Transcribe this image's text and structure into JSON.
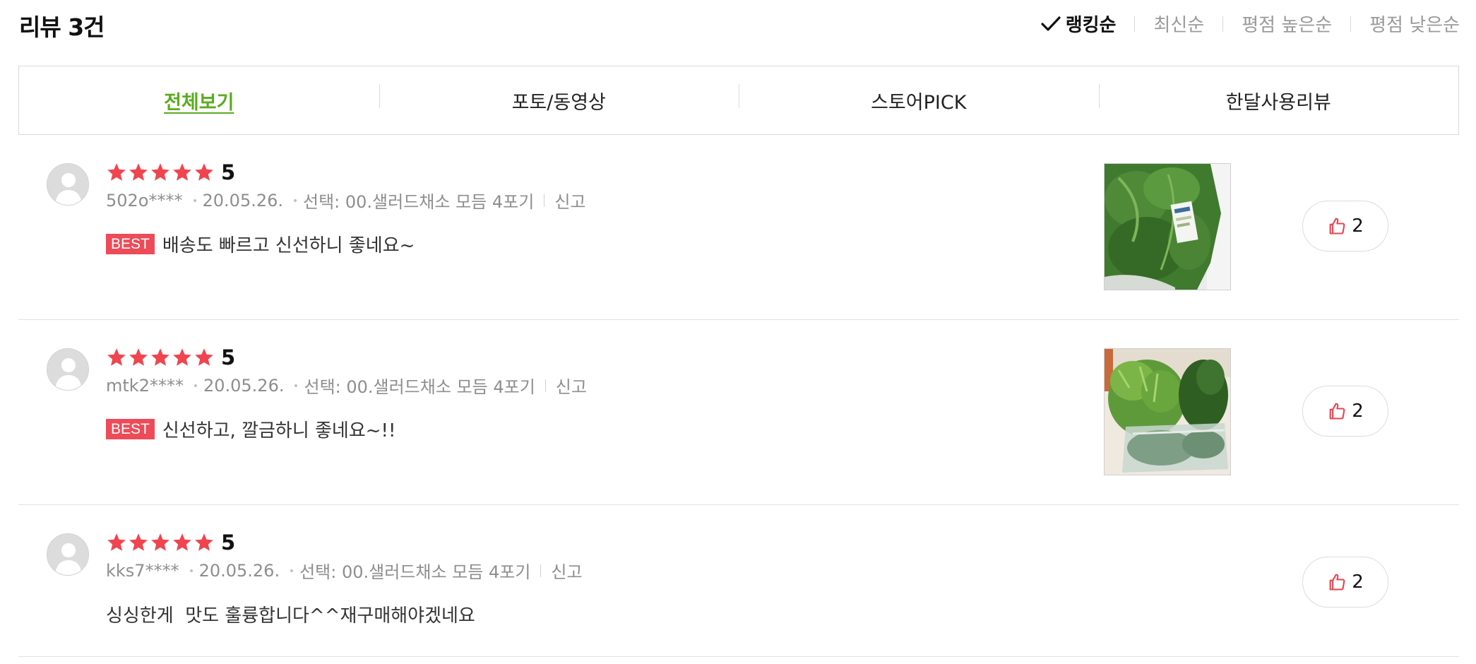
{
  "header": {
    "title": "리뷰 3건"
  },
  "sort": [
    {
      "label": "랭킹순",
      "active": true
    },
    {
      "label": "최신순",
      "active": false
    },
    {
      "label": "평점 높은순",
      "active": false
    },
    {
      "label": "평점 낮은순",
      "active": false
    }
  ],
  "tabs": [
    {
      "label": "전체보기",
      "active": true
    },
    {
      "label": "포토/동영상",
      "active": false
    },
    {
      "label": "스토어PICK",
      "active": false
    },
    {
      "label": "한달사용리뷰",
      "active": false
    }
  ],
  "colors": {
    "accent_green": "#5aac1f",
    "star_red": "#f0454f",
    "best_red": "#ee4b58"
  },
  "reviews": [
    {
      "rating": 5,
      "score": "5",
      "user": "502o****",
      "date": "20.05.26.",
      "option": "선택: 00.샐러드채소 모듬 4포기",
      "report": "신고",
      "best": "BEST",
      "text": "배송도 빠르고 신선하니 좋네요~",
      "likes": "2",
      "has_photo": true
    },
    {
      "rating": 5,
      "score": "5",
      "user": "mtk2****",
      "date": "20.05.26.",
      "option": "선택: 00.샐러드채소 모듬 4포기",
      "report": "신고",
      "best": "BEST",
      "text": "신선하고, 깔금하니 좋네요~!!",
      "likes": "2",
      "has_photo": true
    },
    {
      "rating": 5,
      "score": "5",
      "user": "kks7****",
      "date": "20.05.26.",
      "option": "선택: 00.샐러드채소 모듬 4포기",
      "report": "신고",
      "best": "",
      "text": "싱싱한게  맛도 훌륭합니다^^재구매해야겠네요",
      "likes": "2",
      "has_photo": false
    }
  ]
}
